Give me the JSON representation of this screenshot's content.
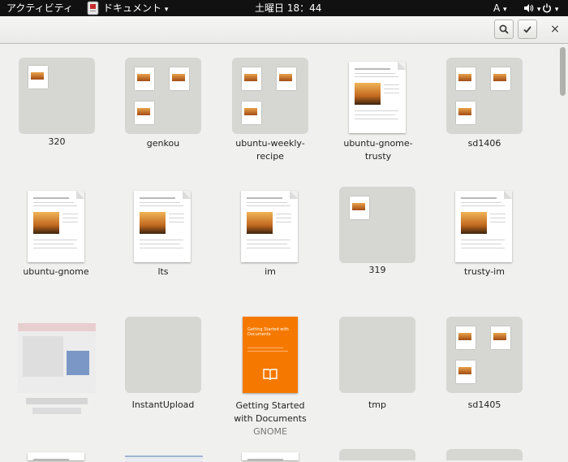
{
  "topbar": {
    "activities": "アクティビティ",
    "app_menu": "ドキュメント",
    "app_menu_arrow": "▾",
    "clock": "土曜日 18：44",
    "input_method": "A",
    "input_method_arrow": "▾",
    "volume_arrow": "▾",
    "power_arrow": "▾"
  },
  "header": {
    "search_icon": "search-icon",
    "select_icon": "checkmark-icon",
    "close_glyph": "×"
  },
  "grid": {
    "row1": [
      {
        "label": "320",
        "kind": "folder"
      },
      {
        "label": "genkou",
        "kind": "folder"
      },
      {
        "label": "ubuntu-weekly-",
        "label2": "recipe",
        "kind": "folder"
      },
      {
        "label": "ubuntu-gnome-",
        "label2": "trusty",
        "kind": "document"
      },
      {
        "label": "sd1406",
        "kind": "folder"
      }
    ],
    "row2": [
      {
        "label": "ubuntu-gnome",
        "kind": "document"
      },
      {
        "label": "lts",
        "kind": "document"
      },
      {
        "label": "im",
        "kind": "document"
      },
      {
        "label": "319",
        "kind": "folder"
      },
      {
        "label": "trusty-im",
        "kind": "document"
      }
    ],
    "row3": [
      {
        "label": "",
        "kind": "blurred"
      },
      {
        "label": "InstantUpload",
        "kind": "folder"
      },
      {
        "label": "Getting Started",
        "label2": "with Documents",
        "sub": "GNOME",
        "kind": "book",
        "cover_title": "Getting Started with Documents"
      },
      {
        "label": "tmp",
        "kind": "folder"
      },
      {
        "label": "sd1405",
        "kind": "folder"
      }
    ]
  },
  "colors": {
    "topbar": "#111111",
    "folder": "#d6d7d2",
    "accent": "#f57900"
  }
}
